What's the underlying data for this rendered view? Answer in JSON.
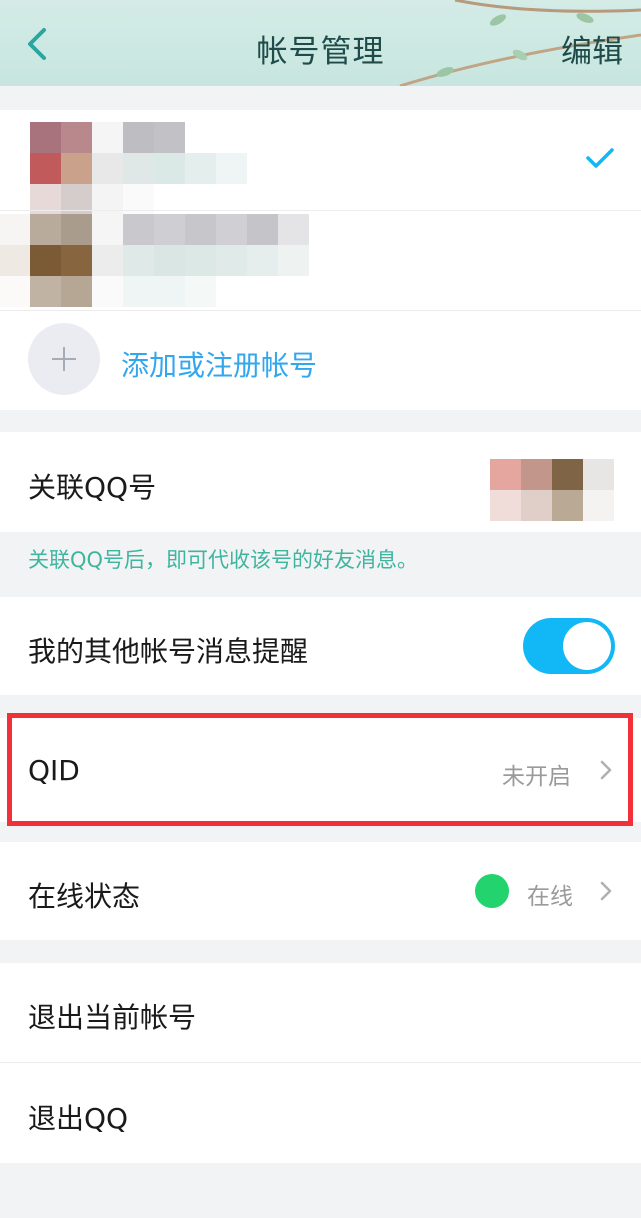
{
  "header": {
    "title": "帐号管理",
    "edit_label": "编辑"
  },
  "accounts": {
    "add_label": "添加或注册帐号"
  },
  "linked_qq": {
    "label": "关联QQ号",
    "hint": "关联QQ号后，即可代收该号的好友消息。"
  },
  "other_account_alerts": {
    "label": "我的其他帐号消息提醒",
    "enabled": true
  },
  "qid": {
    "label": "QID",
    "value": "未开启"
  },
  "online_status": {
    "label": "在线状态",
    "value": "在线",
    "dot_color": "#22d36e"
  },
  "logout_current": {
    "label": "退出当前帐号"
  },
  "logout_qq": {
    "label": "退出QQ"
  },
  "colors": {
    "accent_blue": "#12b7f5",
    "link_blue": "#33a7ee",
    "hint_teal": "#3fb5a0",
    "highlight_red": "#f2303a"
  },
  "icons": {
    "back": "chevron-left-icon",
    "selected": "check-icon",
    "add": "plus-icon",
    "chevron": "chevron-right-icon"
  }
}
